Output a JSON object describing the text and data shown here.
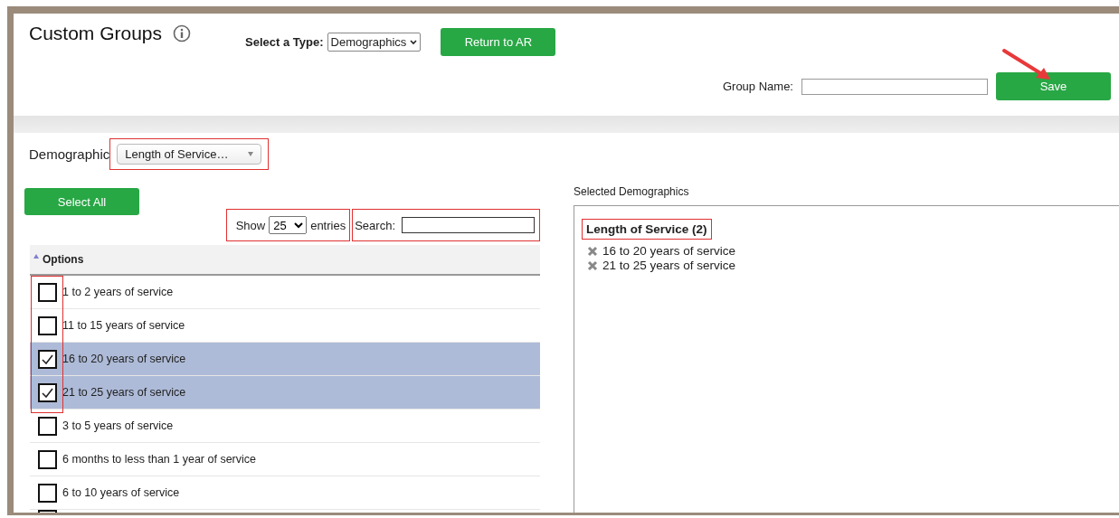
{
  "header": {
    "title": "Custom Groups",
    "type_label": "Select a Type:",
    "type_value": "Demographics",
    "return_button": "Return to AR"
  },
  "group_name": {
    "label": "Group Name:"
  },
  "save_button": {
    "label": "Save",
    "arrow": true
  },
  "demographic": {
    "label": "Demographic",
    "value": "Length of Service…",
    "annotated": true
  },
  "select_all": "Select All",
  "table": {
    "show_label": "Show",
    "page_size": "25",
    "entries_label": "entries",
    "show_annotated": true,
    "search_label": "Search:",
    "search_annotated": true,
    "column": "Options",
    "checkbox_column_annotated": true,
    "rows": [
      {
        "label": "1 to 2 years of service",
        "checked": false
      },
      {
        "label": "11 to 15 years of service",
        "checked": false
      },
      {
        "label": "16 to 20 years of service",
        "checked": true
      },
      {
        "label": "21 to 25 years of service",
        "checked": true
      },
      {
        "label": "3 to 5 years of service",
        "checked": false
      },
      {
        "label": "6 months to less than 1 year of service",
        "checked": false
      },
      {
        "label": "6 to 10 years of service",
        "checked": false
      }
    ]
  },
  "selected": {
    "title": "Selected Demographics",
    "group_title": "Length of Service (2)",
    "group_annotated": true,
    "items": [
      "16 to 20 years of service",
      "21 to 25 years of service"
    ]
  }
}
